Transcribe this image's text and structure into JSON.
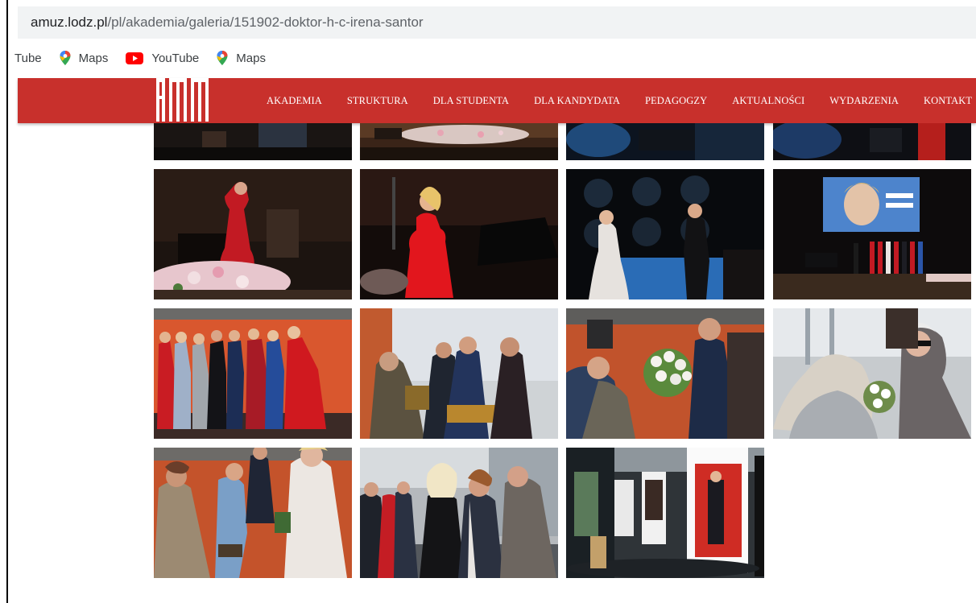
{
  "browser": {
    "address_host": "amuz.lodz.pl",
    "address_path": "/pl/akademia/galeria/151902-doktor-h-c-irena-santor"
  },
  "bookmarks": [
    {
      "label": "Tube",
      "icon": "youtube-icon"
    },
    {
      "label": "Maps",
      "icon": "maps-pin-icon"
    },
    {
      "label": "YouTube",
      "icon": "youtube-icon"
    },
    {
      "label": "Maps",
      "icon": "maps-pin-icon"
    }
  ],
  "site": {
    "brand_color": "#c8302c",
    "logo_icon": "am-logo-icon",
    "nav": [
      "AKADEMIA",
      "STRUKTURA",
      "DLA STUDENTA",
      "DLA KANDYDATA",
      "PEDAGOGZY",
      "AKTUALNOŚCI",
      "WYDARZENIA",
      "KONTAKT"
    ]
  },
  "gallery": {
    "photos": [
      {
        "scene": "concert-stage-partial"
      },
      {
        "scene": "flowers-stage-partial"
      },
      {
        "scene": "piano-blue-partial"
      },
      {
        "scene": "singer-red-partial"
      },
      {
        "scene": "singer-red-dress-flowers"
      },
      {
        "scene": "singer-red-dress-piano"
      },
      {
        "scene": "duet-blue-stage"
      },
      {
        "scene": "stage-screen-choir"
      },
      {
        "scene": "group-red-dresses"
      },
      {
        "scene": "award-presentation"
      },
      {
        "scene": "roses-bouquet"
      },
      {
        "scene": "embrace-flowers"
      },
      {
        "scene": "greeting-bow"
      },
      {
        "scene": "group-lobby"
      },
      {
        "scene": "exhibition-hall"
      }
    ]
  }
}
